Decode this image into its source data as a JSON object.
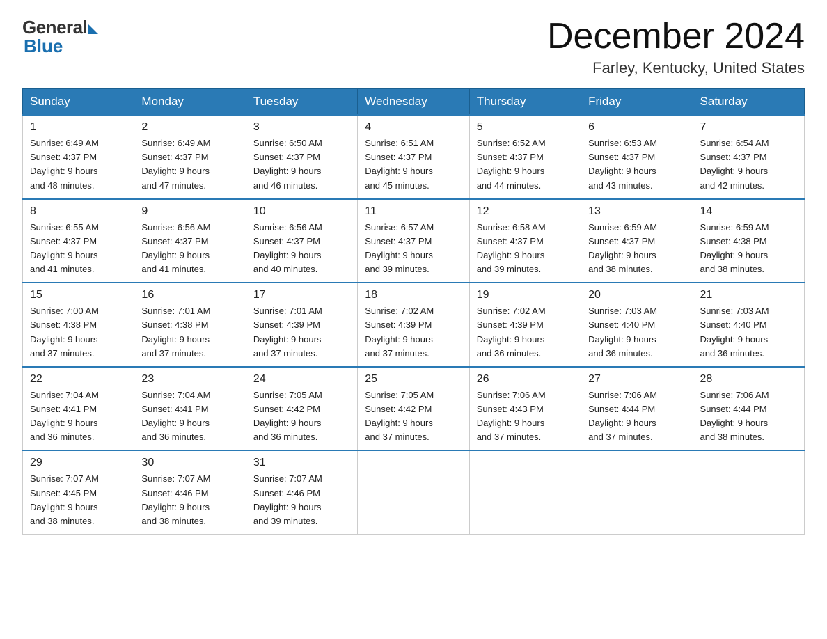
{
  "header": {
    "logo_general": "General",
    "logo_blue": "Blue",
    "title": "December 2024",
    "location": "Farley, Kentucky, United States"
  },
  "weekdays": [
    "Sunday",
    "Monday",
    "Tuesday",
    "Wednesday",
    "Thursday",
    "Friday",
    "Saturday"
  ],
  "weeks": [
    [
      {
        "num": "1",
        "sunrise": "6:49 AM",
        "sunset": "4:37 PM",
        "daylight": "9 hours and 48 minutes."
      },
      {
        "num": "2",
        "sunrise": "6:49 AM",
        "sunset": "4:37 PM",
        "daylight": "9 hours and 47 minutes."
      },
      {
        "num": "3",
        "sunrise": "6:50 AM",
        "sunset": "4:37 PM",
        "daylight": "9 hours and 46 minutes."
      },
      {
        "num": "4",
        "sunrise": "6:51 AM",
        "sunset": "4:37 PM",
        "daylight": "9 hours and 45 minutes."
      },
      {
        "num": "5",
        "sunrise": "6:52 AM",
        "sunset": "4:37 PM",
        "daylight": "9 hours and 44 minutes."
      },
      {
        "num": "6",
        "sunrise": "6:53 AM",
        "sunset": "4:37 PM",
        "daylight": "9 hours and 43 minutes."
      },
      {
        "num": "7",
        "sunrise": "6:54 AM",
        "sunset": "4:37 PM",
        "daylight": "9 hours and 42 minutes."
      }
    ],
    [
      {
        "num": "8",
        "sunrise": "6:55 AM",
        "sunset": "4:37 PM",
        "daylight": "9 hours and 41 minutes."
      },
      {
        "num": "9",
        "sunrise": "6:56 AM",
        "sunset": "4:37 PM",
        "daylight": "9 hours and 41 minutes."
      },
      {
        "num": "10",
        "sunrise": "6:56 AM",
        "sunset": "4:37 PM",
        "daylight": "9 hours and 40 minutes."
      },
      {
        "num": "11",
        "sunrise": "6:57 AM",
        "sunset": "4:37 PM",
        "daylight": "9 hours and 39 minutes."
      },
      {
        "num": "12",
        "sunrise": "6:58 AM",
        "sunset": "4:37 PM",
        "daylight": "9 hours and 39 minutes."
      },
      {
        "num": "13",
        "sunrise": "6:59 AM",
        "sunset": "4:37 PM",
        "daylight": "9 hours and 38 minutes."
      },
      {
        "num": "14",
        "sunrise": "6:59 AM",
        "sunset": "4:38 PM",
        "daylight": "9 hours and 38 minutes."
      }
    ],
    [
      {
        "num": "15",
        "sunrise": "7:00 AM",
        "sunset": "4:38 PM",
        "daylight": "9 hours and 37 minutes."
      },
      {
        "num": "16",
        "sunrise": "7:01 AM",
        "sunset": "4:38 PM",
        "daylight": "9 hours and 37 minutes."
      },
      {
        "num": "17",
        "sunrise": "7:01 AM",
        "sunset": "4:39 PM",
        "daylight": "9 hours and 37 minutes."
      },
      {
        "num": "18",
        "sunrise": "7:02 AM",
        "sunset": "4:39 PM",
        "daylight": "9 hours and 37 minutes."
      },
      {
        "num": "19",
        "sunrise": "7:02 AM",
        "sunset": "4:39 PM",
        "daylight": "9 hours and 36 minutes."
      },
      {
        "num": "20",
        "sunrise": "7:03 AM",
        "sunset": "4:40 PM",
        "daylight": "9 hours and 36 minutes."
      },
      {
        "num": "21",
        "sunrise": "7:03 AM",
        "sunset": "4:40 PM",
        "daylight": "9 hours and 36 minutes."
      }
    ],
    [
      {
        "num": "22",
        "sunrise": "7:04 AM",
        "sunset": "4:41 PM",
        "daylight": "9 hours and 36 minutes."
      },
      {
        "num": "23",
        "sunrise": "7:04 AM",
        "sunset": "4:41 PM",
        "daylight": "9 hours and 36 minutes."
      },
      {
        "num": "24",
        "sunrise": "7:05 AM",
        "sunset": "4:42 PM",
        "daylight": "9 hours and 36 minutes."
      },
      {
        "num": "25",
        "sunrise": "7:05 AM",
        "sunset": "4:42 PM",
        "daylight": "9 hours and 37 minutes."
      },
      {
        "num": "26",
        "sunrise": "7:06 AM",
        "sunset": "4:43 PM",
        "daylight": "9 hours and 37 minutes."
      },
      {
        "num": "27",
        "sunrise": "7:06 AM",
        "sunset": "4:44 PM",
        "daylight": "9 hours and 37 minutes."
      },
      {
        "num": "28",
        "sunrise": "7:06 AM",
        "sunset": "4:44 PM",
        "daylight": "9 hours and 38 minutes."
      }
    ],
    [
      {
        "num": "29",
        "sunrise": "7:07 AM",
        "sunset": "4:45 PM",
        "daylight": "9 hours and 38 minutes."
      },
      {
        "num": "30",
        "sunrise": "7:07 AM",
        "sunset": "4:46 PM",
        "daylight": "9 hours and 38 minutes."
      },
      {
        "num": "31",
        "sunrise": "7:07 AM",
        "sunset": "4:46 PM",
        "daylight": "9 hours and 39 minutes."
      },
      null,
      null,
      null,
      null
    ]
  ],
  "labels": {
    "sunrise": "Sunrise:",
    "sunset": "Sunset:",
    "daylight": "Daylight:"
  }
}
